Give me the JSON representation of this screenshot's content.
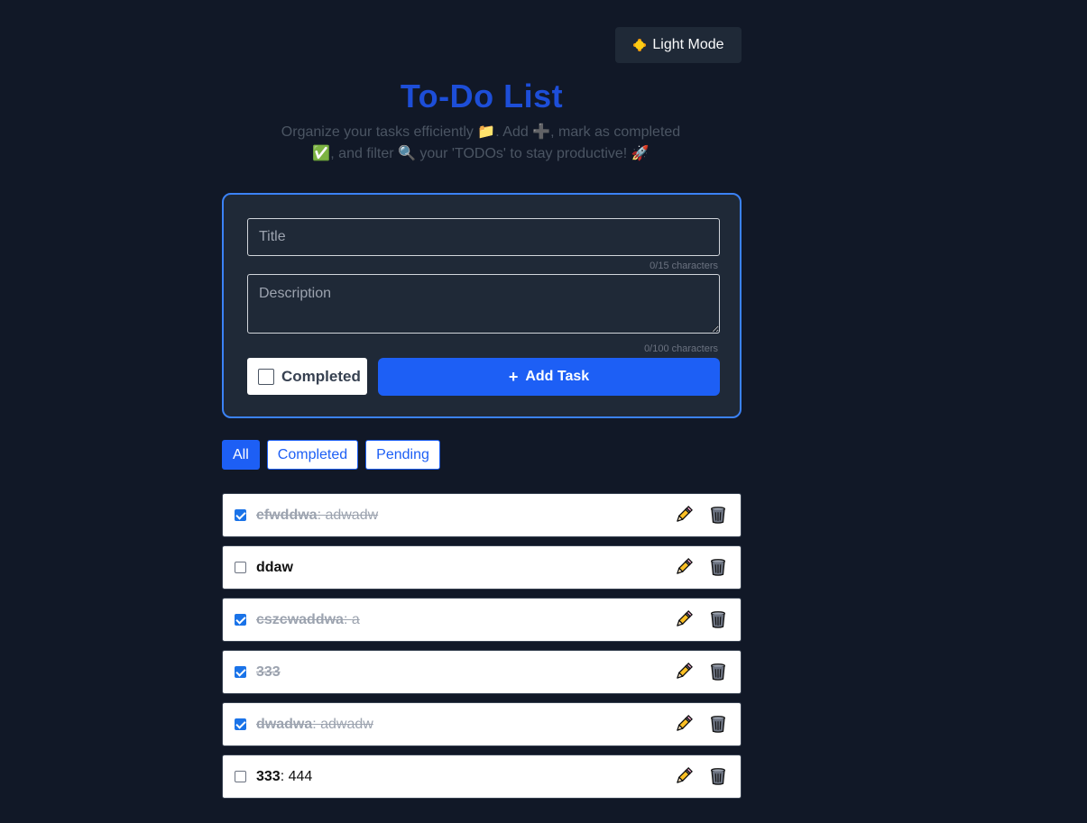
{
  "theme_toggle": {
    "label": "Light Mode",
    "icon": "sun-icon"
  },
  "header": {
    "title": "To-Do List",
    "subtitle": "Organize your tasks efficiently 📁. Add ➕, mark as completed ✅, and filter 🔍 your 'TODOs' to stay productive! 🚀"
  },
  "form": {
    "title_placeholder": "Title",
    "title_counter": "0/15 characters",
    "description_placeholder": "Description",
    "description_counter": "0/100 characters",
    "completed_label": "Completed",
    "add_button_label": "Add Task"
  },
  "filters": [
    {
      "label": "All",
      "active": true
    },
    {
      "label": "Completed",
      "active": false
    },
    {
      "label": "Pending",
      "active": false
    }
  ],
  "tasks": [
    {
      "title": "efwddwa",
      "description": "adwadw",
      "completed": true
    },
    {
      "title": "ddaw",
      "description": "",
      "completed": false
    },
    {
      "title": "cszcwaddwa",
      "description": "a",
      "completed": true
    },
    {
      "title": "333",
      "description": "",
      "completed": true
    },
    {
      "title": "dwadwa",
      "description": "adwadw",
      "completed": true
    },
    {
      "title": "333",
      "description": "444",
      "completed": false
    }
  ],
  "colors": {
    "background": "#111827",
    "accent": "#1d5ff5",
    "title": "#1d4ed8",
    "card_border": "#3b82f6"
  }
}
